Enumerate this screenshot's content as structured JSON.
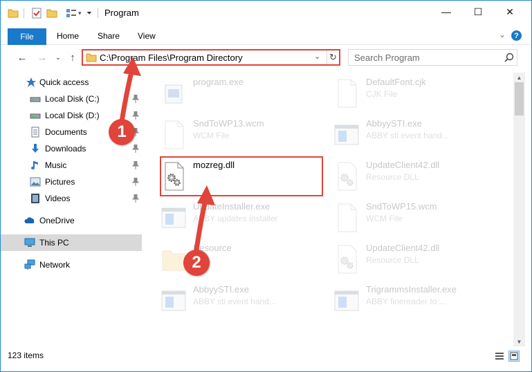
{
  "window": {
    "title": "Program",
    "controls": {
      "minimize": "—",
      "maximize": "☐",
      "close": "✕"
    }
  },
  "ribbon": {
    "tabs": [
      "File",
      "Home",
      "Share",
      "View"
    ],
    "collapse_glyph": "⌄",
    "help_glyph": "?"
  },
  "nav": {
    "back_glyph": "←",
    "forward_glyph": "→",
    "recent_glyph": "⌄",
    "up_glyph": "↑",
    "address": "C:\\Program Files\\Program Directory",
    "dropdown_glyph": "⌄",
    "refresh_glyph": "↻",
    "search_placeholder": "Search Program"
  },
  "sidebar": {
    "items": [
      {
        "label": "Quick access",
        "icon": "star-icon",
        "pinned": false
      },
      {
        "label": "Local Disk (C:)",
        "icon": "drive-icon",
        "pinned": true
      },
      {
        "label": "Local Disk (D:)",
        "icon": "drive-icon",
        "pinned": true
      },
      {
        "label": "Documents",
        "icon": "documents-icon",
        "pinned": true
      },
      {
        "label": "Downloads",
        "icon": "downloads-icon",
        "pinned": true
      },
      {
        "label": "Music",
        "icon": "music-icon",
        "pinned": true
      },
      {
        "label": "Pictures",
        "icon": "pictures-icon",
        "pinned": true
      },
      {
        "label": "Videos",
        "icon": "videos-icon",
        "pinned": true
      },
      {
        "label": "OneDrive",
        "icon": "onedrive-icon",
        "pinned": false
      },
      {
        "label": "This PC",
        "icon": "pc-icon",
        "pinned": false,
        "selected": true
      },
      {
        "label": "Network",
        "icon": "network-icon",
        "pinned": false
      }
    ]
  },
  "files": [
    {
      "name": "program.exe",
      "type": "",
      "icon": "exe-icon",
      "faded": true
    },
    {
      "name": "DefaultFont.cjk",
      "type": "CJK File",
      "icon": "blank-file-icon",
      "faded": true
    },
    {
      "name": "SndToWP13.wcm",
      "type": "WCM File",
      "icon": "blank-file-icon",
      "faded": true
    },
    {
      "name": "AbbyySTI.exe",
      "type": "ABBY sti event hand...",
      "icon": "window-app-icon",
      "faded": true
    },
    {
      "name": "mozreg.dll",
      "type": "",
      "icon": "dll-gear-icon",
      "faded": false
    },
    {
      "name": "UpdateClient42.dll",
      "type": "Resource DLL",
      "icon": "dll-gear-icon",
      "faded": true
    },
    {
      "name": "UpdateInstaller.exe",
      "type": "ABBY updates installer",
      "icon": "window-app-icon",
      "faded": true
    },
    {
      "name": "SndToWP15.wcm",
      "type": "WCM File",
      "icon": "blank-file-icon",
      "faded": true
    },
    {
      "name": "Resource",
      "type": "",
      "icon": "folder-icon",
      "faded": true
    },
    {
      "name": "UpdateClient42.dll",
      "type": "Resource DLL",
      "icon": "dll-gear-icon",
      "faded": true
    },
    {
      "name": "AbbyySTI.exe",
      "type": "ABBY sti event hand...",
      "icon": "window-app-icon",
      "faded": true
    },
    {
      "name": "TrigrammsInstaller.exe",
      "type": "ABBY finereader to ...",
      "icon": "window-app-icon",
      "faded": true
    }
  ],
  "status": {
    "item_count": "123 items"
  },
  "annotations": {
    "callout_1": "1",
    "callout_2": "2",
    "color": "#e0443a"
  },
  "colors": {
    "accent": "#1979ca",
    "highlight": "#e0443a",
    "selected": "#d9d9d9"
  }
}
